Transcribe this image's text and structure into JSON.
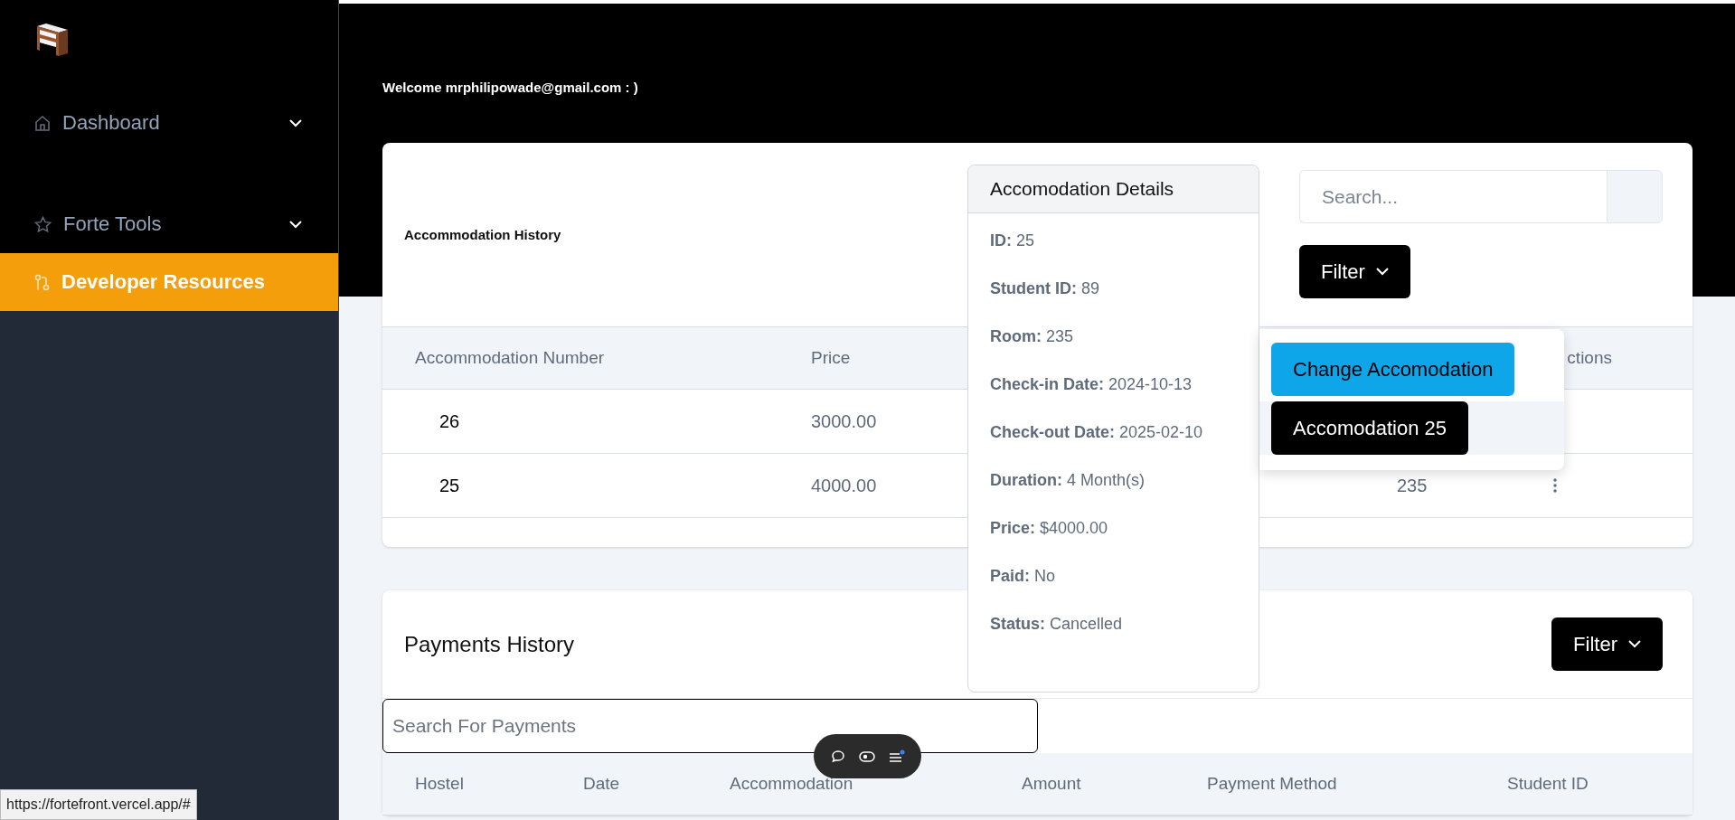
{
  "sidebar": {
    "items": [
      {
        "label": "Dashboard",
        "expandable": true,
        "selected": false
      },
      {
        "label": "Forte Tools",
        "expandable": true,
        "selected": false
      },
      {
        "label": "Developer Resources",
        "expandable": false,
        "selected": true
      }
    ]
  },
  "header": {
    "welcome": "Welcome mrphilipowade@gmail.com : )"
  },
  "accommodation_card": {
    "title": "Accommodation History",
    "search": {
      "placeholder": "Search..."
    },
    "filter_button": "Filter",
    "table": {
      "columns": [
        {
          "label": "Accommodation Number"
        },
        {
          "label": "Price"
        },
        {},
        {
          "label": "ctions"
        }
      ],
      "rows": [
        {
          "number": "26",
          "price": "3000.00",
          "actions_visible": false
        },
        {
          "number": "25",
          "price": "4000.00",
          "room": "235",
          "actions_visible": true
        }
      ]
    }
  },
  "details_popover": {
    "title": "Accomodation Details",
    "fields": [
      {
        "label": "ID:",
        "value": "25"
      },
      {
        "label": "Student ID:",
        "value": "89"
      },
      {
        "label": "Room:",
        "value": "235"
      },
      {
        "label": "Check-in Date:",
        "value": "2024-10-13"
      },
      {
        "label": "Check-out Date:",
        "value": "2025-02-10"
      },
      {
        "label": "Duration:",
        "value": "4 Month(s)"
      },
      {
        "label": "Price:",
        "value": "$4000.00"
      },
      {
        "label": "Paid:",
        "value": "No"
      },
      {
        "label": "Status:",
        "value": "Cancelled"
      }
    ]
  },
  "actions_menu": {
    "items": [
      {
        "label": "Change Accomodation",
        "kind": "primary"
      },
      {
        "label": "Accomodation 25",
        "kind": "dark"
      }
    ]
  },
  "payments_card": {
    "title": "Payments History",
    "filter_button": "Filter",
    "search": {
      "placeholder": "Search For Payments"
    },
    "table": {
      "columns": [
        "Hostel",
        "Date",
        "Accommodation",
        "Amount",
        "Payment Method",
        "Student ID"
      ]
    }
  },
  "status_url": "https://fortefront.vercel.app/#"
}
